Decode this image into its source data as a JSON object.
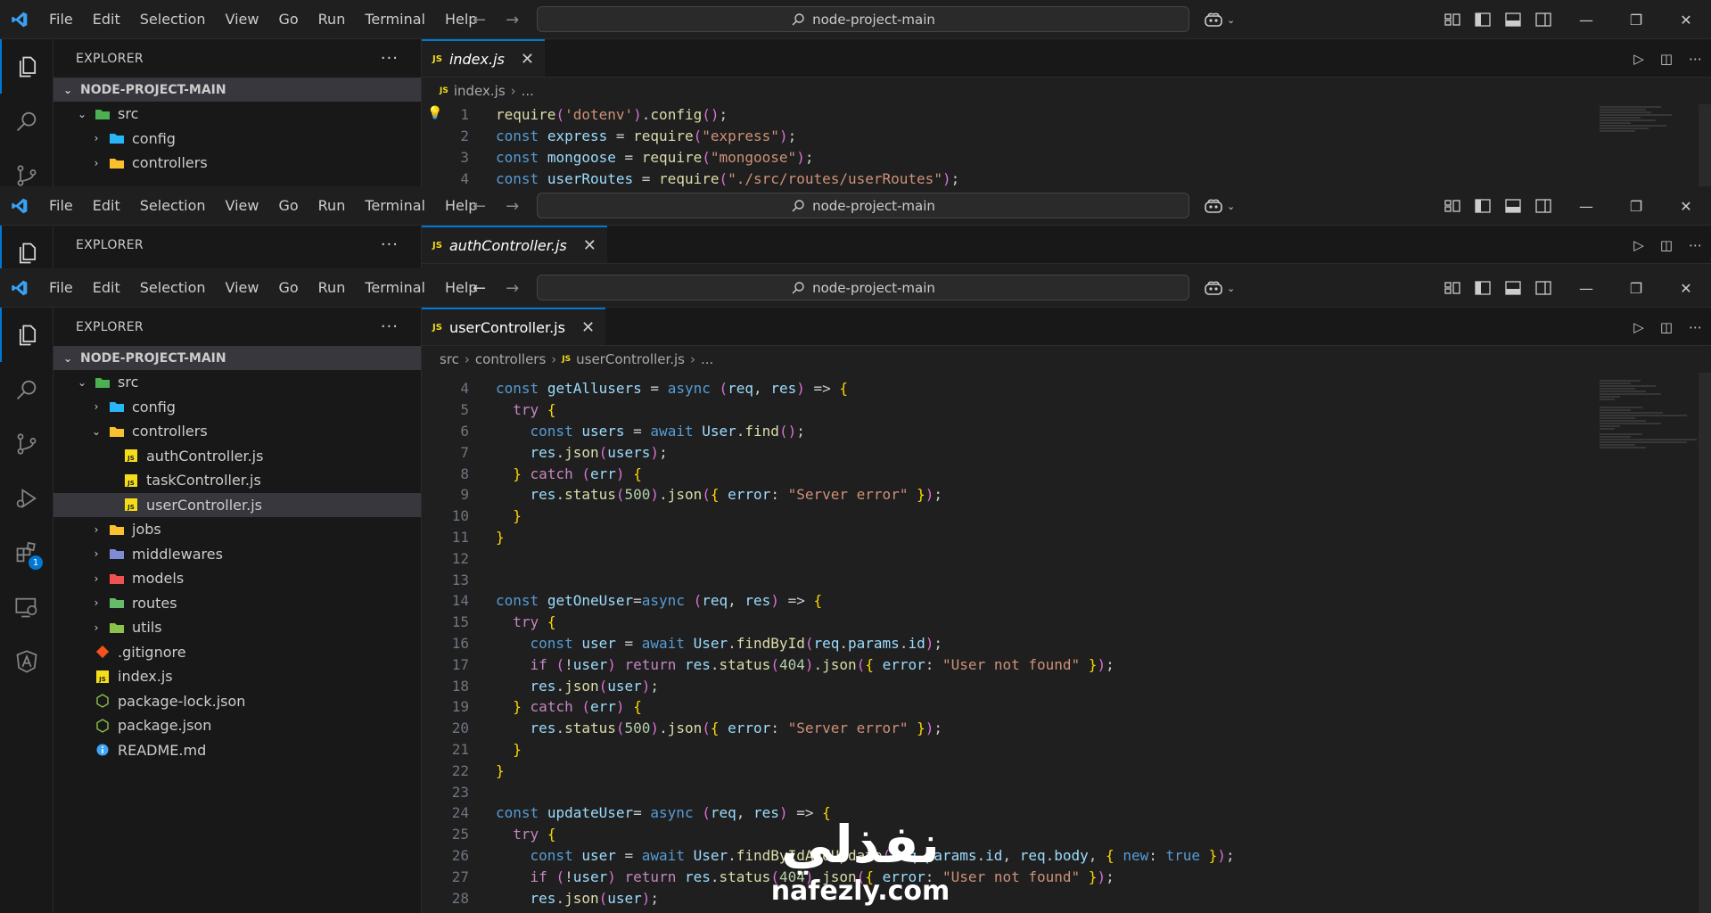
{
  "menu": [
    "File",
    "Edit",
    "Selection",
    "View",
    "Go",
    "Run",
    "Terminal",
    "Help"
  ],
  "search_text": "node-project-main",
  "explorer_title": "EXPLORER",
  "explorer_more": "···",
  "root_folder": "NODE-PROJECT-MAIN",
  "windows": [
    {
      "tab": "index.js",
      "breadcrumb": [
        "index.js",
        "..."
      ],
      "tree": [
        "src",
        "config",
        "controllers"
      ],
      "code": [
        {
          "n": "1",
          "t": "require('dotenv').config();"
        },
        {
          "n": "2",
          "t": "const express = require(\"express\");"
        },
        {
          "n": "3",
          "t": "const mongoose = require(\"mongoose\");"
        },
        {
          "n": "4",
          "t": "const userRoutes = require(\"./src/routes/userRoutes\");"
        }
      ]
    },
    {
      "tab": "authController.js"
    },
    {
      "tab": "userController.js",
      "breadcrumb": [
        "src",
        "controllers",
        "userController.js",
        "..."
      ],
      "tree": [
        {
          "label": "src",
          "level": 1,
          "chev": "open",
          "icon": "src-folder-icon"
        },
        {
          "label": "config",
          "level": 2,
          "chev": "closed",
          "icon": "config-folder-icon"
        },
        {
          "label": "controllers",
          "level": 2,
          "chev": "open",
          "icon": "controllers-folder-icon"
        },
        {
          "label": "authController.js",
          "level": 3,
          "chev": "none",
          "icon": "js-file-icon"
        },
        {
          "label": "taskController.js",
          "level": 3,
          "chev": "none",
          "icon": "js-file-icon"
        },
        {
          "label": "userController.js",
          "level": 3,
          "chev": "none",
          "icon": "js-file-icon",
          "selected": true
        },
        {
          "label": "jobs",
          "level": 2,
          "chev": "closed",
          "icon": "jobs-folder-icon"
        },
        {
          "label": "middlewares",
          "level": 2,
          "chev": "closed",
          "icon": "middlewares-folder-icon"
        },
        {
          "label": "models",
          "level": 2,
          "chev": "closed",
          "icon": "models-folder-icon"
        },
        {
          "label": "routes",
          "level": 2,
          "chev": "closed",
          "icon": "routes-folder-icon"
        },
        {
          "label": "utils",
          "level": 2,
          "chev": "closed",
          "icon": "utils-folder-icon"
        },
        {
          "label": ".gitignore",
          "level": 1,
          "chev": "none",
          "icon": "git-file-icon"
        },
        {
          "label": "index.js",
          "level": 1,
          "chev": "none",
          "icon": "js-file-icon"
        },
        {
          "label": "package-lock.json",
          "level": 1,
          "chev": "none",
          "icon": "node-file-icon"
        },
        {
          "label": "package.json",
          "level": 1,
          "chev": "none",
          "icon": "node-file-icon"
        },
        {
          "label": "README.md",
          "level": 1,
          "chev": "none",
          "icon": "info-file-icon"
        }
      ],
      "code": [
        {
          "n": "4",
          "t": "const getAllusers = async (req, res) => {"
        },
        {
          "n": "5",
          "t": "  try {"
        },
        {
          "n": "6",
          "t": "    const users = await User.find();"
        },
        {
          "n": "7",
          "t": "    res.json(users);"
        },
        {
          "n": "8",
          "t": "  } catch (err) {"
        },
        {
          "n": "9",
          "t": "    res.status(500).json({ error: \"Server error\" });"
        },
        {
          "n": "10",
          "t": "  }"
        },
        {
          "n": "11",
          "t": "}"
        },
        {
          "n": "12",
          "t": ""
        },
        {
          "n": "13",
          "t": ""
        },
        {
          "n": "14",
          "t": "const getOneUser=async (req, res) => {"
        },
        {
          "n": "15",
          "t": "  try {"
        },
        {
          "n": "16",
          "t": "    const user = await User.findById(req.params.id);"
        },
        {
          "n": "17",
          "t": "    if (!user) return res.status(404).json({ error: \"User not found\" });"
        },
        {
          "n": "18",
          "t": "    res.json(user);"
        },
        {
          "n": "19",
          "t": "  } catch (err) {"
        },
        {
          "n": "20",
          "t": "    res.status(500).json({ error: \"Server error\" });"
        },
        {
          "n": "21",
          "t": "  }"
        },
        {
          "n": "22",
          "t": "}"
        },
        {
          "n": "23",
          "t": ""
        },
        {
          "n": "24",
          "t": "const updateUser= async (req, res) => {"
        },
        {
          "n": "25",
          "t": "  try {"
        },
        {
          "n": "26",
          "t": "    const user = await User.findByIdAndUpdate(req.params.id, req.body, { new: true });"
        },
        {
          "n": "27",
          "t": "    if (!user) return res.status(404).json({ error: \"User not found\" });"
        },
        {
          "n": "28",
          "t": "    res.json(user);"
        }
      ]
    }
  ],
  "extensions_badge": "1",
  "watermark": {
    "arabic": "نفذلي",
    "latin": "nafezly.com"
  },
  "colors": {
    "accent": "#0078d4",
    "background": "#1f1f1f",
    "sidebar": "#181818",
    "selection": "#37373d"
  }
}
